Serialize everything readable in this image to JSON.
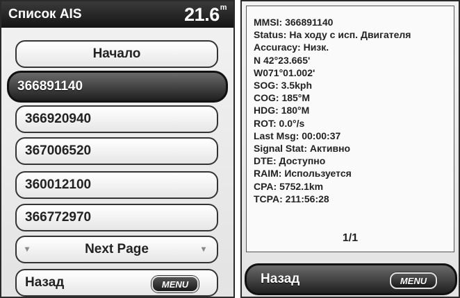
{
  "left_screen": {
    "title": "Список AIS",
    "depth_value": "21.6",
    "depth_unit": "m",
    "items": [
      {
        "label": "Начало"
      },
      {
        "label": "366891140"
      },
      {
        "label": "366920940"
      },
      {
        "label": "367006520"
      },
      {
        "label": "360012100"
      },
      {
        "label": "366772970"
      }
    ],
    "next_page_label": "Next Page",
    "back_label": "Назад",
    "menu_label": "MENU"
  },
  "right_screen": {
    "lines": [
      "MMSI: 366891140",
      "Status: На ходу с исп. Двигателя",
      "Accuracy: Низк.",
      "N  42°23.665'",
      "W071°01.002'",
      "SOG: 3.5kph",
      "COG: 185°M",
      "HDG: 180°M",
      "ROT: 0.0°/s",
      "Last Msg: 00:00:37",
      "Signal Stat: Активно",
      "DTE: Доступно",
      "RAIM: Используется",
      "CPA: 5752.1km",
      "TCPA: 211:56:28"
    ],
    "page_indicator": "1/1",
    "back_label": "Назад",
    "menu_label": "MENU"
  }
}
